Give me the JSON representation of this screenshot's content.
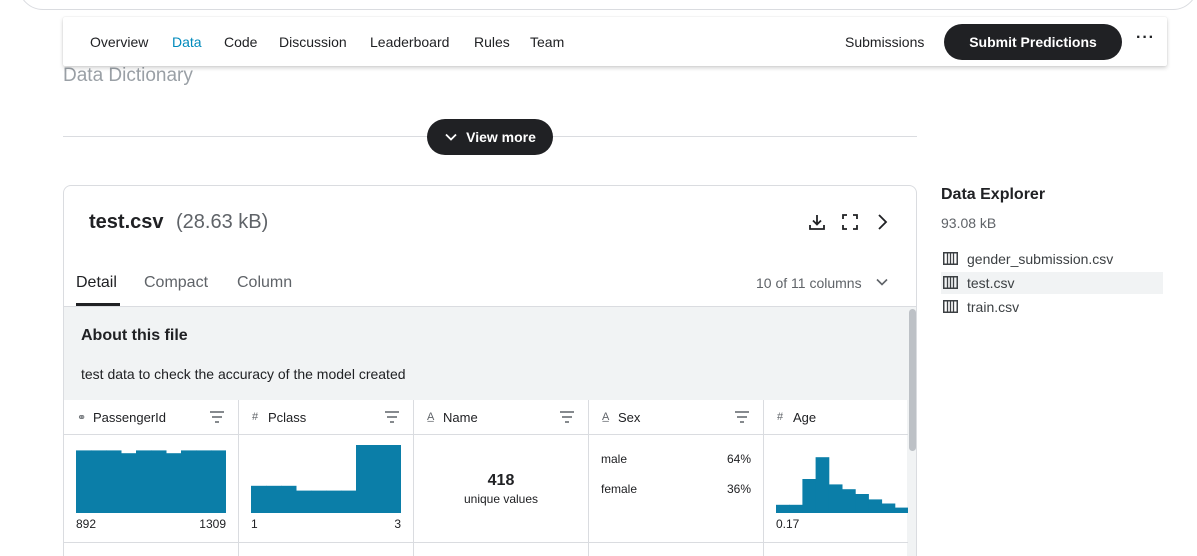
{
  "nav": {
    "tabs": [
      "Overview",
      "Data",
      "Code",
      "Discussion",
      "Leaderboard",
      "Rules",
      "Team"
    ],
    "active_tab": "Data",
    "submissions_label": "Submissions",
    "submit_label": "Submit Predictions",
    "more_icon": "more-horizontal-icon"
  },
  "section": {
    "heading": "Data Dictionary",
    "view_more_label": "View more"
  },
  "file": {
    "name": "test.csv",
    "size": "(28.63 kB)",
    "subtabs": [
      "Detail",
      "Compact",
      "Column"
    ],
    "active_subtab": "Detail",
    "columns_selector": "10 of 11 columns",
    "about_title": "About this file",
    "about_desc": "test data to check the accuracy of the model created",
    "columns": [
      {
        "type_icon": "id-icon",
        "name": "PassengerId",
        "min": "892",
        "max": "1309",
        "hist": [
          0.92,
          0.92,
          0.92,
          0.88,
          0.92,
          0.92,
          0.88,
          0.92,
          0.92,
          0.92
        ]
      },
      {
        "type_icon": "hash-icon",
        "name": "Pclass",
        "min": "1",
        "max": "3",
        "hist": [
          0.4,
          0.4,
          0.4,
          0.33,
          0.33,
          0.33,
          0.33,
          1.0,
          1.0,
          1.0
        ]
      },
      {
        "type_icon": "text-icon",
        "name": "Name",
        "unique_count": "418",
        "unique_label": "unique values"
      },
      {
        "type_icon": "text-icon",
        "name": "Sex",
        "categories": [
          {
            "label": "male",
            "pct": "64%"
          },
          {
            "label": "female",
            "pct": "36%"
          }
        ]
      },
      {
        "type_icon": "hash-icon",
        "name": "Age",
        "min": "0.17",
        "hist": [
          0.12,
          0.12,
          0.5,
          0.82,
          0.42,
          0.35,
          0.28,
          0.2,
          0.14,
          0.08
        ]
      }
    ]
  },
  "explorer": {
    "title": "Data Explorer",
    "size": "93.08 kB",
    "files": [
      "gender_submission.csv",
      "test.csv",
      "train.csv"
    ],
    "active_file": "test.csv"
  },
  "colors": {
    "accent_dark": "#202124",
    "histogram": "#0b7ea8"
  }
}
